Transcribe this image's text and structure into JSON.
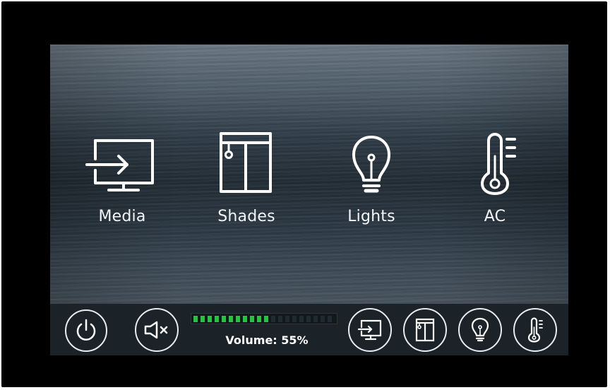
{
  "tiles": [
    {
      "id": "media",
      "label": "Media",
      "icon": "display-input-icon"
    },
    {
      "id": "shades",
      "label": "Shades",
      "icon": "window-shade-icon"
    },
    {
      "id": "lights",
      "label": "Lights",
      "icon": "lightbulb-icon"
    },
    {
      "id": "ac",
      "label": "AC",
      "icon": "thermometer-icon"
    }
  ],
  "bottom_bar": {
    "power_icon": "power-icon",
    "mute_icon": "speaker-muted-icon",
    "volume": {
      "label": "Volume: 55%",
      "level": 0.55,
      "fill_color": "#22c442",
      "empty_color": "#1f2a31"
    },
    "shortcuts": [
      {
        "id": "media",
        "icon": "display-input-icon"
      },
      {
        "id": "shades",
        "icon": "window-shade-icon"
      },
      {
        "id": "lights",
        "icon": "lightbulb-icon"
      },
      {
        "id": "ac",
        "icon": "thermometer-icon"
      }
    ]
  },
  "colors": {
    "bezel": "#000000",
    "icon_stroke": "#ffffff",
    "bar_background": "#1b2329"
  }
}
